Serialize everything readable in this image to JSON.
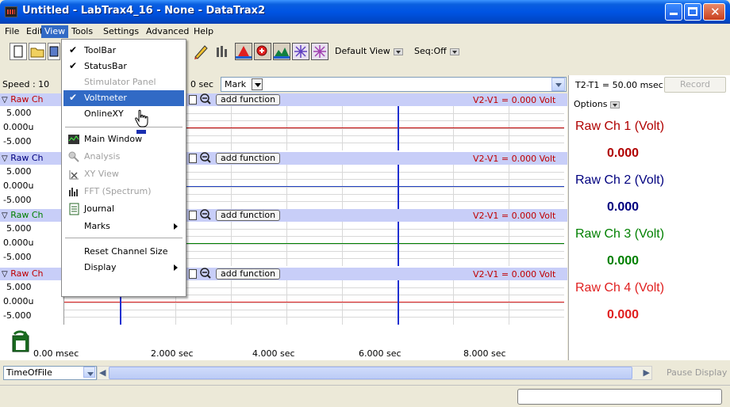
{
  "window": {
    "title": "Untitled - LabTrax4_16 - None - DataTrax2"
  },
  "menubar": {
    "items": [
      "File",
      "Edit",
      "View",
      "Tools",
      "Settings",
      "Advanced",
      "Help"
    ]
  },
  "toolbar": {
    "default_view": "Default View",
    "seq": "Seq:Off"
  },
  "speed_row": {
    "speed": "Speed : 10",
    "time": "0 sec",
    "mark_label": "Mark"
  },
  "right_panel": {
    "t2t1": "T2-T1 = 50.00 msec",
    "record": "Record",
    "options": "Options",
    "voltmeter": [
      {
        "label": "Raw Ch 1 (Volt)",
        "value": "0.000",
        "color": "#b00000"
      },
      {
        "label": "Raw Ch 2 (Volt)",
        "value": "0.000",
        "color": "#00007f"
      },
      {
        "label": "Raw Ch 3 (Volt)",
        "value": "0.000",
        "color": "#008000"
      },
      {
        "label": "Raw Ch 4 (Volt)",
        "value": "0.000",
        "color": "#e02020"
      }
    ]
  },
  "channels": [
    {
      "name": "Raw Ch",
      "color": "#c00000",
      "top": "5.000",
      "mid": "0.000u",
      "bot": "-5.000",
      "add_function": "add function",
      "vdiff": "V2-V1 = 0.000 Volt",
      "signal_color": "#c00000"
    },
    {
      "name": "Raw Ch",
      "color": "#00007f",
      "top": "5.000",
      "mid": "0.000u",
      "bot": "-5.000",
      "add_function": "add function",
      "vdiff": "V2-V1 = 0.000 Volt",
      "signal_color": "#2040c0"
    },
    {
      "name": "Raw Ch",
      "color": "#008000",
      "top": "5.000",
      "mid": "0.000u",
      "bot": "-5.000",
      "add_function": "add function",
      "vdiff": "V2-V1 = 0.000 Volt",
      "signal_color": "#008000"
    },
    {
      "name": "Raw Ch",
      "color": "#c00000",
      "top": "5.000",
      "mid": "0.000u",
      "bot": "-5.000",
      "add_function": "add function",
      "vdiff": "V2-V1 = 0.000 Volt",
      "signal_color": "#e02020"
    }
  ],
  "timeline": {
    "labels": [
      "0.00 msec",
      "2.000 sec",
      "4.000 sec",
      "6.000 sec",
      "8.000 sec"
    ]
  },
  "bottom": {
    "time_of_file": "TimeOfFile",
    "pause": "Pause Display"
  },
  "view_menu": {
    "toolbar": "ToolBar",
    "statusbar": "StatusBar",
    "stimulator": "Stimulator Panel",
    "voltmeter": "Voltmeter",
    "onlinexy": "OnlineXY",
    "main_window": "Main Window",
    "analysis": "Analysis",
    "xy_view": "XY View",
    "fft": "FFT (Spectrum)",
    "journal": "Journal",
    "marks": "Marks",
    "reset": "Reset Channel Size",
    "display": "Display"
  }
}
